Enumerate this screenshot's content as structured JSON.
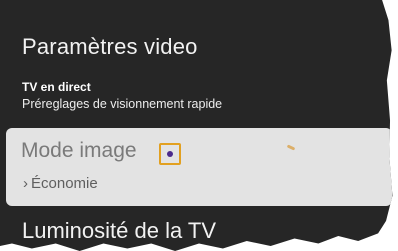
{
  "header": {
    "title": "Paramètres video"
  },
  "section": {
    "title": "TV en direct",
    "subtitle": "Préreglages de visionnement rapide"
  },
  "menu": {
    "selected_item": {
      "label": "Mode image",
      "value": "Économie",
      "chevron": "›"
    },
    "next_item": {
      "label": "Luminosité de la TV"
    }
  },
  "colors": {
    "background": "#262626",
    "selection_background": "#e3e3e3",
    "focus_marker": "#e2a020",
    "dot": "#4b2a8c"
  }
}
